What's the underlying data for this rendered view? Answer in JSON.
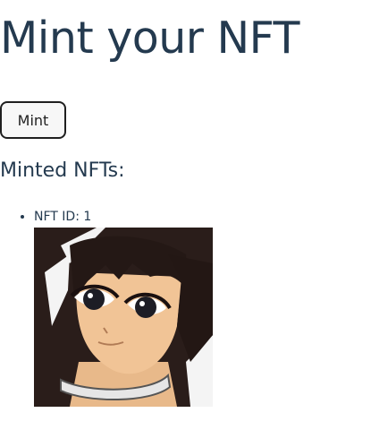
{
  "page": {
    "title": "Mint your NFT",
    "mint_button_label": "Mint",
    "minted_heading": "Minted NFTs:"
  },
  "nfts": [
    {
      "id_label": "NFT ID: 1",
      "image_subject": "anime-girl-portrait"
    }
  ],
  "colors": {
    "text": "#243a4f",
    "button_border": "#1f1f1f",
    "button_bg": "#f7f7f7"
  }
}
